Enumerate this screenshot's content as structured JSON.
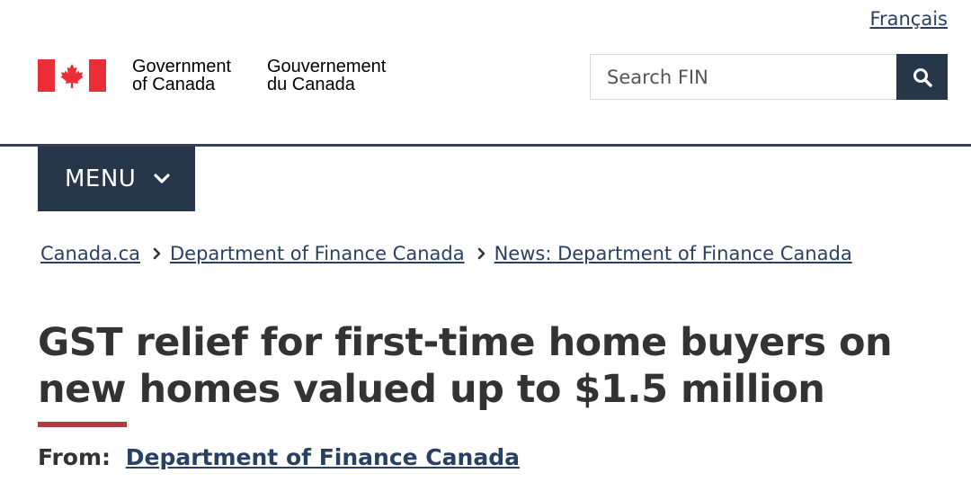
{
  "header": {
    "language_link": "Français",
    "wordmark_en": [
      "Government",
      "of Canada"
    ],
    "wordmark_fr": [
      "Gouvernement",
      "du Canada"
    ],
    "flag_colors": {
      "red": "#eb2d37",
      "white": "#ffffff"
    },
    "search": {
      "placeholder": "Search FIN",
      "icon": "search-icon"
    },
    "menu_label": "MENU",
    "menu_icon": "chevron-down-icon"
  },
  "breadcrumb": [
    "Canada.ca",
    "Department of Finance Canada",
    "News: Department of Finance Canada"
  ],
  "main": {
    "title": "GST relief for first-time home buyers on new homes valued up to $1.5 million",
    "from_label": "From:",
    "from_link": "Department of Finance Canada"
  },
  "colors": {
    "brand_dark": "#26374a",
    "link": "#284162",
    "accent": "#af3c43",
    "text": "#333333"
  }
}
